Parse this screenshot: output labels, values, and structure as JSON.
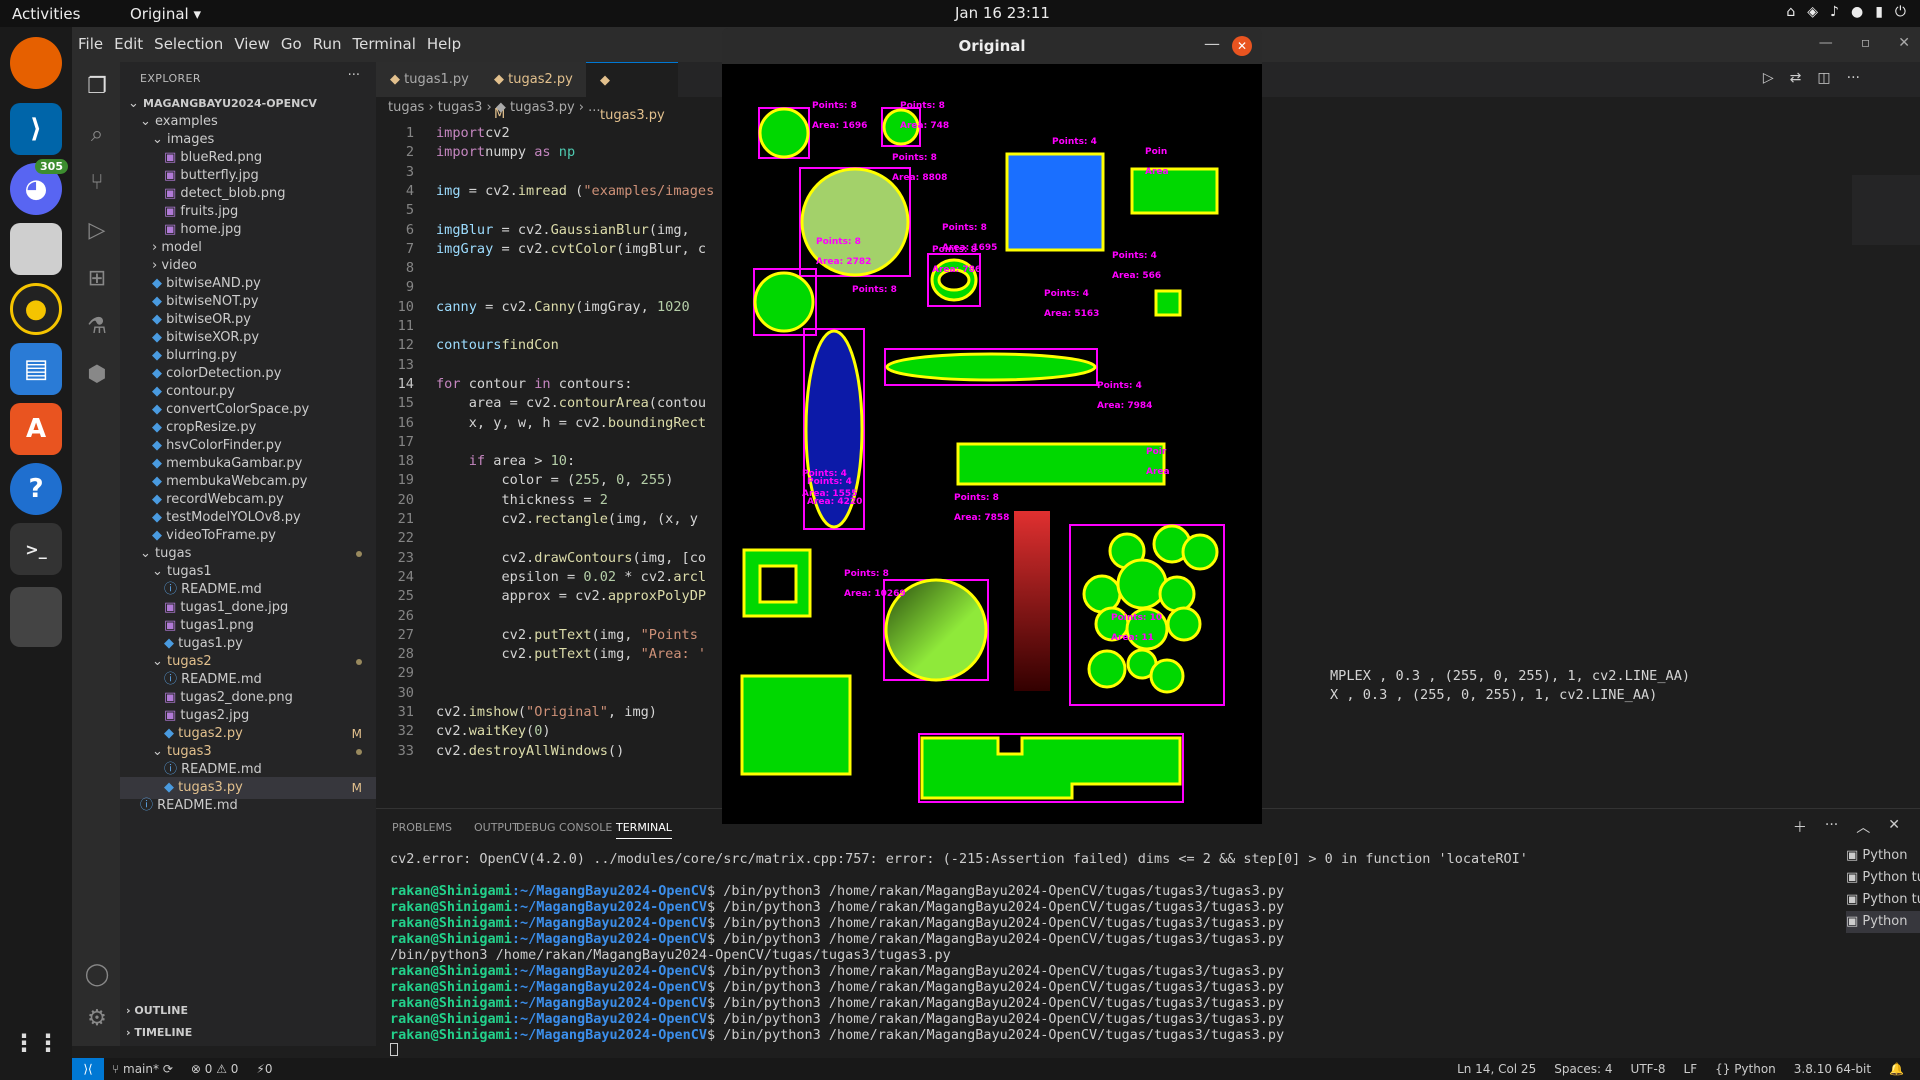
{
  "topbar": {
    "activities": "Activities",
    "app": "Original ▾",
    "clock": "Jan 16  23:11",
    "tray": [
      "⌂",
      "◈",
      "♪",
      "●",
      "▮",
      "⏻"
    ]
  },
  "dock": {
    "badge": "305"
  },
  "vscode": {
    "menu": [
      "File",
      "Edit",
      "Selection",
      "View",
      "Go",
      "Run",
      "Terminal",
      "Help"
    ],
    "explorer_title": "EXPLORER",
    "explorer_more": "···",
    "tree": [
      {
        "label": "MAGANGBAYU2024-OPENCV",
        "depth": 0,
        "folder": true,
        "open": true,
        "bold": true
      },
      {
        "label": "examples",
        "depth": 1,
        "folder": true,
        "open": true
      },
      {
        "label": "images",
        "depth": 2,
        "folder": true,
        "open": true
      },
      {
        "label": "blueRed.png",
        "depth": 3,
        "icon": "image"
      },
      {
        "label": "butterfly.jpg",
        "depth": 3,
        "icon": "image"
      },
      {
        "label": "detect_blob.png",
        "depth": 3,
        "icon": "image"
      },
      {
        "label": "fruits.jpg",
        "depth": 3,
        "icon": "image"
      },
      {
        "label": "home.jpg",
        "depth": 3,
        "icon": "image"
      },
      {
        "label": "model",
        "depth": 2,
        "folder": true,
        "open": false
      },
      {
        "label": "video",
        "depth": 2,
        "folder": true,
        "open": false
      },
      {
        "label": "bitwiseAND.py",
        "depth": 2,
        "icon": "py"
      },
      {
        "label": "bitwiseNOT.py",
        "depth": 2,
        "icon": "py"
      },
      {
        "label": "bitwiseOR.py",
        "depth": 2,
        "icon": "py"
      },
      {
        "label": "bitwiseXOR.py",
        "depth": 2,
        "icon": "py"
      },
      {
        "label": "blurring.py",
        "depth": 2,
        "icon": "py"
      },
      {
        "label": "colorDetection.py",
        "depth": 2,
        "icon": "py"
      },
      {
        "label": "contour.py",
        "depth": 2,
        "icon": "py"
      },
      {
        "label": "convertColorSpace.py",
        "depth": 2,
        "icon": "py"
      },
      {
        "label": "cropResize.py",
        "depth": 2,
        "icon": "py"
      },
      {
        "label": "hsvColorFinder.py",
        "depth": 2,
        "icon": "py"
      },
      {
        "label": "membukaGambar.py",
        "depth": 2,
        "icon": "py"
      },
      {
        "label": "membukaWebcam.py",
        "depth": 2,
        "icon": "py"
      },
      {
        "label": "recordWebcam.py",
        "depth": 2,
        "icon": "py"
      },
      {
        "label": "testModelYOLOv8.py",
        "depth": 2,
        "icon": "py"
      },
      {
        "label": "videoToFrame.py",
        "depth": 2,
        "icon": "py"
      },
      {
        "label": "tugas",
        "depth": 1,
        "folder": true,
        "open": true,
        "dot": true
      },
      {
        "label": "tugas1",
        "depth": 2,
        "folder": true,
        "open": true
      },
      {
        "label": "README.md",
        "depth": 3,
        "icon": "info"
      },
      {
        "label": "tugas1_done.jpg",
        "depth": 3,
        "icon": "image"
      },
      {
        "label": "tugas1.png",
        "depth": 3,
        "icon": "image"
      },
      {
        "label": "tugas1.py",
        "depth": 3,
        "icon": "py"
      },
      {
        "label": "tugas2",
        "depth": 2,
        "folder": true,
        "open": true,
        "dot": true,
        "mod": true
      },
      {
        "label": "README.md",
        "depth": 3,
        "icon": "info"
      },
      {
        "label": "tugas2_done.png",
        "depth": 3,
        "icon": "image"
      },
      {
        "label": "tugas2.jpg",
        "depth": 3,
        "icon": "image"
      },
      {
        "label": "tugas2.py",
        "depth": 3,
        "icon": "py",
        "mark": "M",
        "mod": true
      },
      {
        "label": "tugas3",
        "depth": 2,
        "folder": true,
        "open": true,
        "dot": true,
        "mod": true
      },
      {
        "label": "README.md",
        "depth": 3,
        "icon": "info"
      },
      {
        "label": "tugas3.py",
        "depth": 3,
        "icon": "py",
        "mark": "M",
        "selected": true,
        "mod": true
      },
      {
        "label": "README.md",
        "depth": 1,
        "icon": "info"
      }
    ],
    "outline": "OUTLINE",
    "timeline": "TIMELINE",
    "tabs": [
      {
        "label": "tugas1.py",
        "mark": ""
      },
      {
        "label": "tugas2.py",
        "mark": "M"
      },
      {
        "label": "tugas3.py",
        "mark": ""
      }
    ],
    "breadcrumb": "tugas  ›  tugas3  ›  ◆ tugas3.py  ›  ...",
    "code": [
      [
        [
          "kw",
          "import"
        ],
        [
          "",
          "cv2"
        ]
      ],
      [
        [
          "kw",
          "import"
        ],
        [
          "",
          "numpy "
        ],
        [
          "kw",
          "as"
        ],
        [
          "mo",
          " np"
        ]
      ],
      [],
      [
        [
          "va",
          "img"
        ],
        [
          "",
          " = cv2."
        ],
        [
          "fn",
          "imread"
        ],
        [
          "",
          " ("
        ],
        [
          "st",
          "\"examples/images"
        ]
      ],
      [],
      [
        [
          "va",
          "imgBlur"
        ],
        [
          "",
          " = cv2."
        ],
        [
          "fn",
          "GaussianBlur"
        ],
        [
          "",
          "(img,"
        ]
      ],
      [
        [
          "va",
          "imgGray"
        ],
        [
          "",
          " = cv2."
        ],
        [
          "fn",
          "cvtColor"
        ],
        [
          "",
          "(imgBlur, c"
        ]
      ],
      [],
      [],
      [
        [
          "va",
          "canny"
        ],
        [
          "",
          " = cv2."
        ],
        [
          "fn",
          "Canny"
        ],
        [
          "",
          "(imgGray, "
        ],
        [
          "nu",
          "10"
        ],
        [
          ", ",
          ""
        ],
        [
          "nu",
          "20"
        ]
      ],
      [],
      [
        [
          "va",
          "contours"
        ],
        [
          ", hierarchy = cv2.",
          ""
        ],
        [
          "fn",
          "findCon"
        ]
      ],
      [],
      [
        [
          "kw",
          "for"
        ],
        [
          "",
          " contour "
        ],
        [
          "kw",
          "in"
        ],
        [
          "",
          " contours:"
        ]
      ],
      [
        [
          "",
          "    area = cv2."
        ],
        [
          "fn",
          "contourArea"
        ],
        [
          "",
          "(contou"
        ]
      ],
      [
        [
          "",
          "    x, y, w, h = cv2."
        ],
        [
          "fn",
          "boundingRect"
        ]
      ],
      [],
      [
        [
          "",
          "    "
        ],
        [
          "kw",
          "if"
        ],
        [
          "",
          " area > "
        ],
        [
          "nu",
          "10"
        ],
        [
          "",
          ":"
        ]
      ],
      [
        [
          "",
          "        color = ("
        ],
        [
          "nu",
          "255"
        ],
        [
          "",
          ", "
        ],
        [
          "nu",
          "0"
        ],
        [
          "",
          ", "
        ],
        [
          "nu",
          "255"
        ],
        [
          "",
          ")"
        ]
      ],
      [
        [
          "",
          "        thickness = "
        ],
        [
          "nu",
          "2"
        ]
      ],
      [
        [
          "",
          "        cv2."
        ],
        [
          "fn",
          "rectangle"
        ],
        [
          "",
          "(img, (x, y"
        ]
      ],
      [],
      [
        [
          "",
          "        cv2."
        ],
        [
          "fn",
          "drawContours"
        ],
        [
          "",
          "(img, [co"
        ]
      ],
      [
        [
          "",
          "        epsilon = "
        ],
        [
          "nu",
          "0.02"
        ],
        [
          "",
          " * cv2."
        ],
        [
          "fn",
          "arcl"
        ]
      ],
      [
        [
          "",
          "        approx = cv2."
        ],
        [
          "fn",
          "approxPolyDP"
        ]
      ],
      [],
      [
        [
          "",
          "        cv2."
        ],
        [
          "fn",
          "putText"
        ],
        [
          "",
          "(img, "
        ],
        [
          "st",
          "\"Points"
        ]
      ],
      [
        [
          "",
          "        cv2."
        ],
        [
          "fn",
          "putText"
        ],
        [
          "",
          "(img, "
        ],
        [
          "st",
          "\"Area: '"
        ]
      ],
      [],
      [],
      [
        [
          "",
          "cv2."
        ],
        [
          "fn",
          "imshow"
        ],
        [
          "",
          "("
        ],
        [
          "st",
          "\"Original\""
        ],
        [
          "",
          ", img)"
        ]
      ],
      [
        [
          "",
          "cv2."
        ],
        [
          "fn",
          "waitKey"
        ],
        [
          "",
          "("
        ],
        [
          "nu",
          "0"
        ],
        [
          "",
          ")"
        ]
      ],
      [
        [
          "",
          "cv2."
        ],
        [
          "fn",
          "destroyAllWindows"
        ],
        [
          "",
          "()"
        ]
      ]
    ],
    "code_tail1": "MPLEX , 0.3 , (255, 0, 255), 1, cv2.LINE_AA)",
    "code_tail2": "X , 0.3 , (255, 0, 255), 1, cv2.LINE_AA)",
    "panel_tabs": [
      "PROBLEMS",
      "OUTPUT",
      "DEBUG CONSOLE",
      "TERMINAL"
    ],
    "terminal": [
      {
        "t": "text",
        "v": "cv2.error: OpenCV(4.2.0) ../modules/core/src/matrix.cpp:757: error: (-215:Assertion failed) dims <= 2 && step[0] > 0 in function 'locateROI'"
      },
      {
        "t": "blank"
      },
      {
        "t": "prompt",
        "v": "/bin/python3 /home/rakan/MagangBayu2024-OpenCV/tugas/tugas3/tugas3.py"
      },
      {
        "t": "prompt",
        "v": "/bin/python3 /home/rakan/MagangBayu2024-OpenCV/tugas/tugas3/tugas3.py"
      },
      {
        "t": "prompt",
        "v": "/bin/python3 /home/rakan/MagangBayu2024-OpenCV/tugas/tugas3/tugas3.py"
      },
      {
        "t": "prompt",
        "v": "/bin/python3 /home/rakan/MagangBayu2024-OpenCV/tugas/tugas3/tugas3.py"
      },
      {
        "t": "text",
        "v": "/bin/python3 /home/rakan/MagangBayu2024-OpenCV/tugas/tugas3/tugas3.py"
      },
      {
        "t": "prompt",
        "v": "/bin/python3 /home/rakan/MagangBayu2024-OpenCV/tugas/tugas3/tugas3.py"
      },
      {
        "t": "prompt",
        "v": "/bin/python3 /home/rakan/MagangBayu2024-OpenCV/tugas/tugas3/tugas3.py"
      },
      {
        "t": "prompt",
        "v": "/bin/python3 /home/rakan/MagangBayu2024-OpenCV/tugas/tugas3/tugas3.py"
      },
      {
        "t": "prompt",
        "v": "/bin/python3 /home/rakan/MagangBayu2024-OpenCV/tugas/tugas3/tugas3.py"
      },
      {
        "t": "prompt",
        "v": "/bin/python3 /home/rakan/MagangBayu2024-OpenCV/tugas/tugas3/tugas3.py"
      }
    ],
    "prompt_user": "rakan@Shinigami",
    "prompt_path": ":~/MagangBayu2024-OpenCV",
    "prompt_dollar": "$ ",
    "terminal_list": [
      "Python",
      "Python tug...",
      "Python tug...",
      "Python"
    ],
    "status_left": [
      "main*",
      "⊗ 0 ⚠ 0",
      "⚡0"
    ],
    "status_right": [
      "Ln 14, Col 25",
      "Spaces: 4",
      "UTF-8",
      "LF",
      "{} Python",
      "3.8.10 64-bit"
    ]
  },
  "cv_window": {
    "title": "Original",
    "labels": [
      [
        "Points: 8",
        "Area: 1696"
      ],
      [
        "Points: 8",
        "Area: 748"
      ],
      [
        "Points: 8",
        "Area: 8808"
      ],
      [
        "Points: 4",
        ""
      ],
      [
        "Poin",
        "Area"
      ],
      [
        "Points: 8",
        "Area: 2782"
      ],
      [
        "Points: 8",
        "Area: 1695"
      ],
      [
        "Points: 8",
        "Area: 786"
      ],
      [
        "Points: 4",
        "Area: 566"
      ],
      [
        "Points: 8",
        ""
      ],
      [
        "Points: 4",
        "Area: 5163"
      ],
      [
        "Points: 4",
        "Area: 7984"
      ],
      [
        "Points: 4",
        "Area: 1555"
      ],
      [
        "Points: 4",
        "Area: 4220"
      ],
      [
        "Points: 8",
        "Area: 7858"
      ],
      [
        "Poir",
        "Area"
      ],
      [
        "Points: 8",
        "Area: 10269"
      ],
      [
        "Points: 10",
        "Area: 11"
      ]
    ]
  }
}
